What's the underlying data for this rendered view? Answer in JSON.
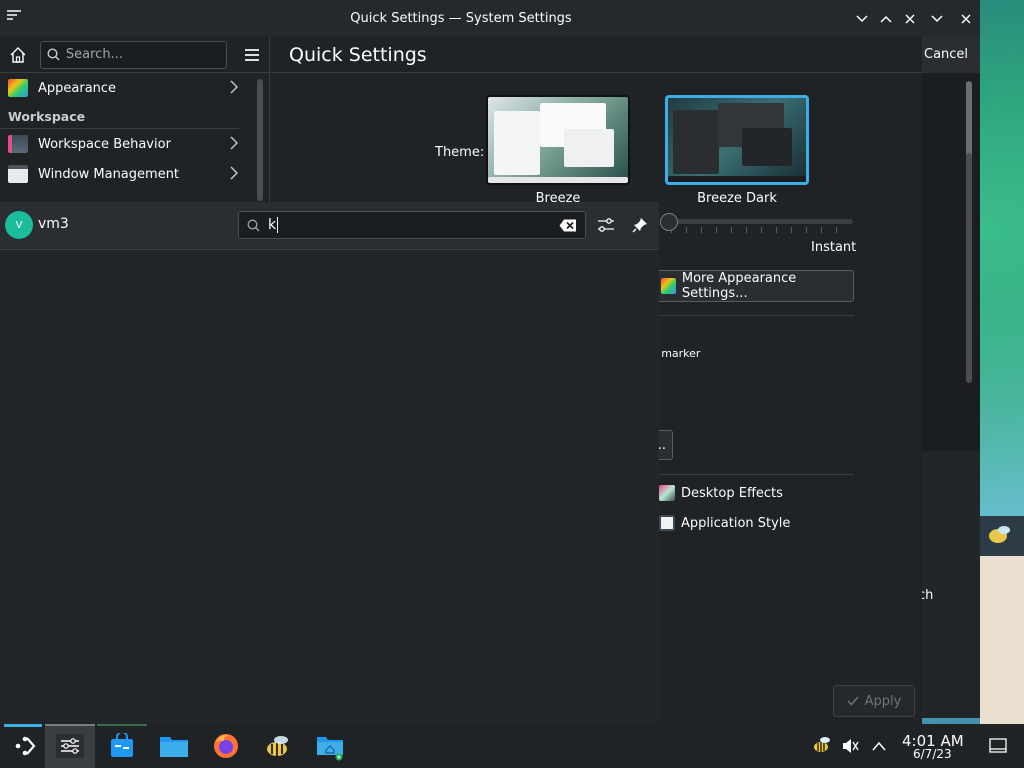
{
  "window": {
    "title": "Quick Settings — System Settings"
  },
  "back_window": {
    "cancel_label": "Cancel",
    "partial_text": "ch"
  },
  "sidebar": {
    "search_placeholder": "Search...",
    "items": [
      {
        "label": "Appearance",
        "icon": "appearance-icon"
      },
      {
        "label": "Workspace Behavior",
        "icon": "workspace-behavior-icon"
      },
      {
        "label": "Window Management",
        "icon": "window-management-icon"
      }
    ],
    "section_heading": "Workspace"
  },
  "content": {
    "page_title": "Quick Settings",
    "theme_label": "Theme:",
    "themes": [
      {
        "name": "Breeze",
        "selected": false
      },
      {
        "name": "Breeze Dark",
        "selected": true
      }
    ],
    "animation_speed_label": "Instant",
    "more_appearance_button": "More Appearance Settings...",
    "marker_text": "on marker",
    "small_button": "..",
    "links": [
      {
        "label": "Desktop Effects",
        "icon": "desktop-effects-icon"
      },
      {
        "label": "Application Style",
        "icon": "application-style-icon"
      }
    ],
    "apply_button": "Apply"
  },
  "launcher": {
    "user_initial": "V",
    "user_name": "vm3",
    "search_value": "k"
  },
  "taskbar": {
    "apps": [
      {
        "name": "application-launcher-icon"
      },
      {
        "name": "system-settings-icon"
      },
      {
        "name": "discover-store-icon"
      },
      {
        "name": "dolphin-files-icon"
      },
      {
        "name": "firefox-icon"
      },
      {
        "name": "bee-app-icon"
      },
      {
        "name": "home-folder-icon"
      }
    ],
    "clock_time": "4:01 AM",
    "clock_date": "6/7/23"
  },
  "colors": {
    "accent": "#3daee9",
    "window_bg": "#202326",
    "avatar": "#1abc9c"
  }
}
